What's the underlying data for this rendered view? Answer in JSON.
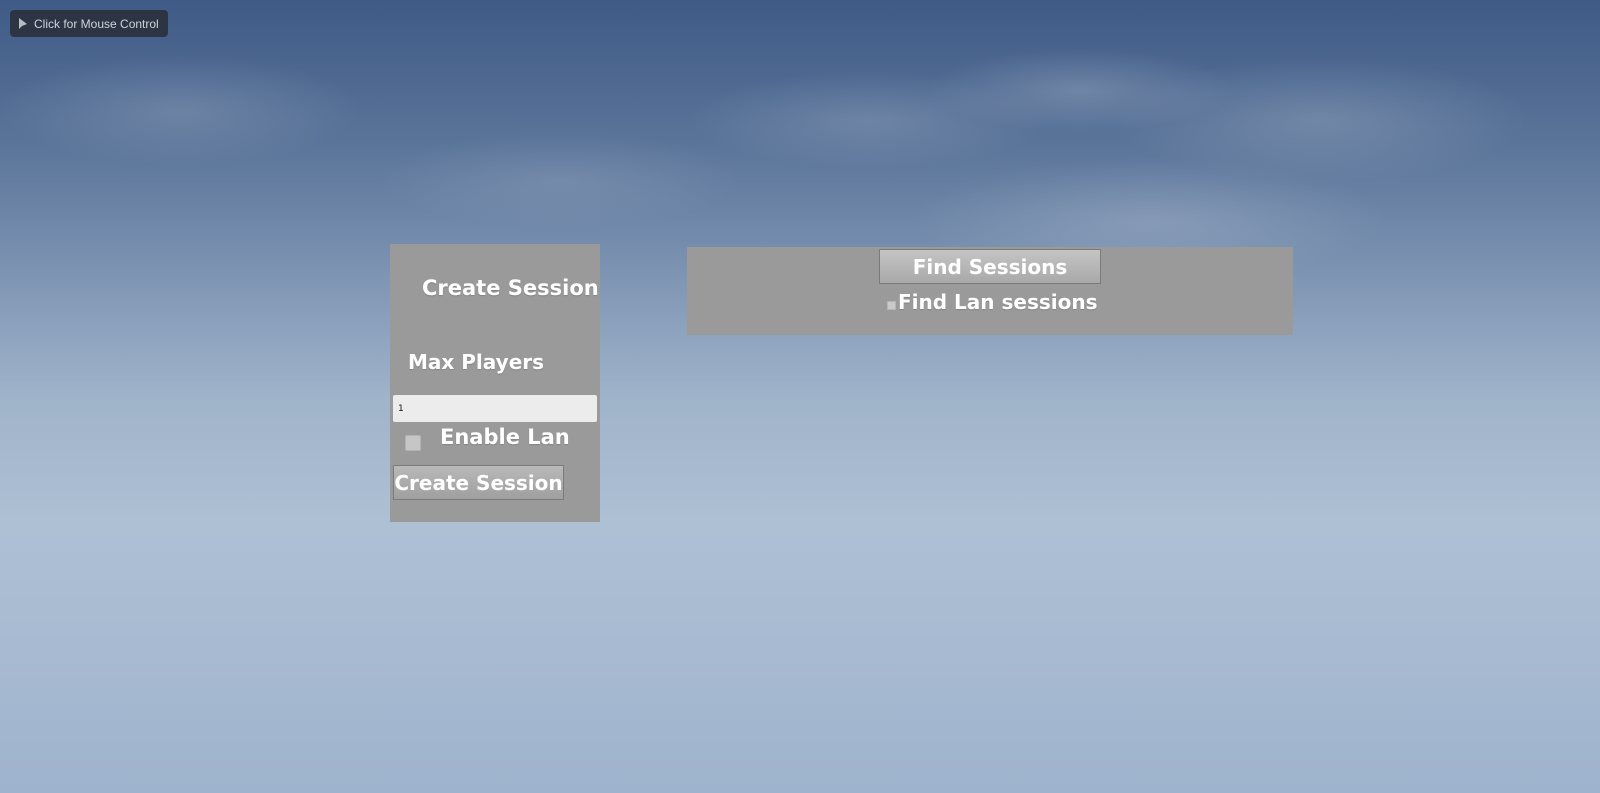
{
  "hint": {
    "icon": "cursor-arrow-icon",
    "label": "Click for Mouse Control"
  },
  "create_panel": {
    "title": "Create Session",
    "max_players_label": "Max Players",
    "max_players_value": "1",
    "enable_lan_label": "Enable Lan",
    "enable_lan_checked": false,
    "create_button_label": "Create Session"
  },
  "find_panel": {
    "find_button_label": "Find Sessions",
    "find_lan_label": "Find Lan sessions",
    "find_lan_checked": false
  },
  "colors": {
    "panel": "#9a9a9a",
    "text": "#ffffff",
    "input": "#ececec"
  }
}
